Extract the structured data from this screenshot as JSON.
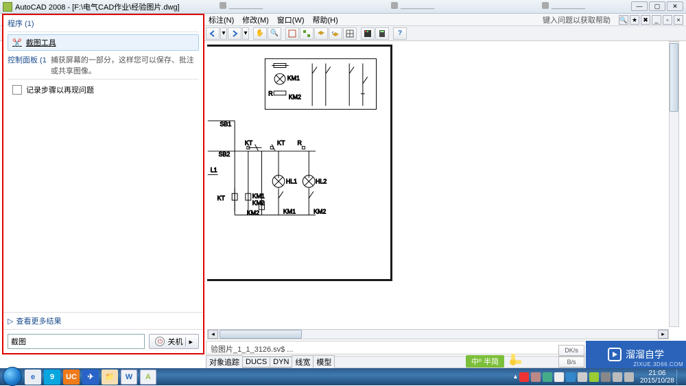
{
  "titlebar": {
    "app_icon": "autocad-icon",
    "title": "AutoCAD 2008 - [F:\\电气CAD作业\\经验图片.dwg]",
    "blurred_tabs": [
      "",
      "",
      ""
    ],
    "min": "—",
    "max": "▢",
    "close": "✕"
  },
  "menubar": {
    "items": [
      "标注(N)",
      "修改(M)",
      "窗口(W)",
      "帮助(H)"
    ],
    "help_search": "键入问题以获取帮助",
    "app_min": "_",
    "app_restore": "▫",
    "app_close": "×",
    "right_icons": [
      "search-icon",
      "star-icon",
      "x-icon"
    ]
  },
  "toolbar": {
    "icons": [
      "undo-icon",
      "redo-icon",
      "pan-icon",
      "zoom-icon",
      "properties-icon",
      "block-icon",
      "layer-icon",
      "layer-prev-icon",
      "table-icon",
      "tool-palettes-icon",
      "calc-icon",
      "help-icon"
    ]
  },
  "start_panel": {
    "section_programs": "程序 (1)",
    "result_label": "截图工具",
    "section_control": "控制面板 (1",
    "desc": "捕获屏幕的一部分，这样您可以保存、批注或共享图像。",
    "record_item": "记录步骤以再现问题",
    "more_results": "查看更多结果",
    "search_value": "截图",
    "shutdown": "关机"
  },
  "cmdline": {
    "text": "验图片_1_1_3126.sv$ ..."
  },
  "status_tabs": {
    "items": [
      "对象追踪",
      "DUCS",
      "DYN",
      "线宽",
      "模型"
    ]
  },
  "ime": {
    "label": "中º 半简"
  },
  "watermark": {
    "text": "溜溜自学",
    "url": "ZIXUE.3D66.COM"
  },
  "right_dock": {
    "items": [
      "DK/s",
      "B/s"
    ]
  },
  "taskbar": {
    "clock_time": "21:06",
    "clock_date": "2015/10/28"
  },
  "circuit": {
    "labels": [
      "KM1",
      "R",
      "KM2",
      "SB1",
      "SB2",
      "KT",
      "KT",
      "R",
      "L1",
      "HL1",
      "HL2",
      "KT",
      "KM1",
      "KM2",
      "KM2",
      "KM1",
      "KM2"
    ]
  }
}
